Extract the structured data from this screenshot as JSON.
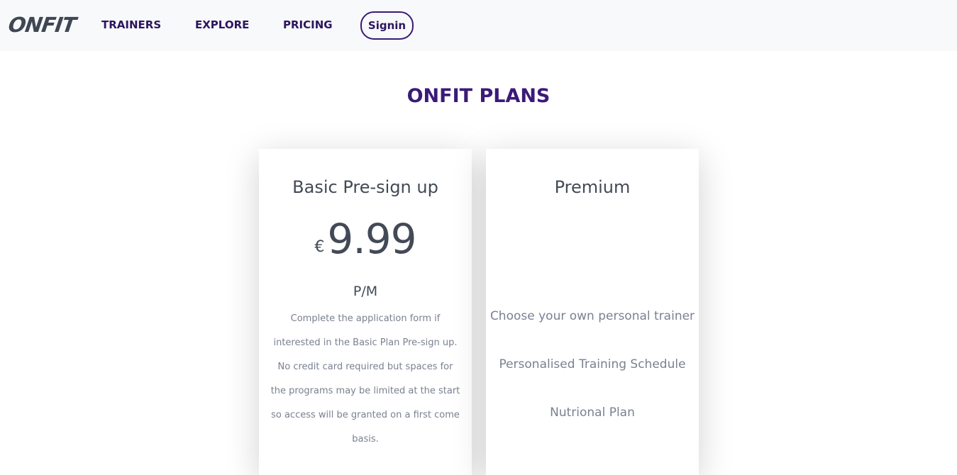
{
  "brand": {
    "logo": "ONFIT"
  },
  "nav": {
    "links": [
      "TRAINERS",
      "EXPLORE",
      "PRICING"
    ],
    "signin": "Signin"
  },
  "page": {
    "title": "ONFIT PLANS"
  },
  "plans": [
    {
      "title": "Basic Pre-sign up",
      "currency": "€",
      "price": "9.99",
      "period": "P/M",
      "description": "Complete the application form if interested in the Basic Plan Pre-sign up. No credit card required but spaces for the programs may be limited at the start so access will be granted on a first come basis."
    },
    {
      "title": "Premium",
      "features": [
        "Choose your own personal trainer",
        "Personalised Training Schedule",
        "Nutrional Plan"
      ]
    }
  ],
  "colors": {
    "brand_purple": "#3b1a78",
    "nav_text": "#2d1560",
    "navbar_bg": "#f8f9fa",
    "heading_text": "#434a56",
    "muted_text": "#7a8190"
  }
}
